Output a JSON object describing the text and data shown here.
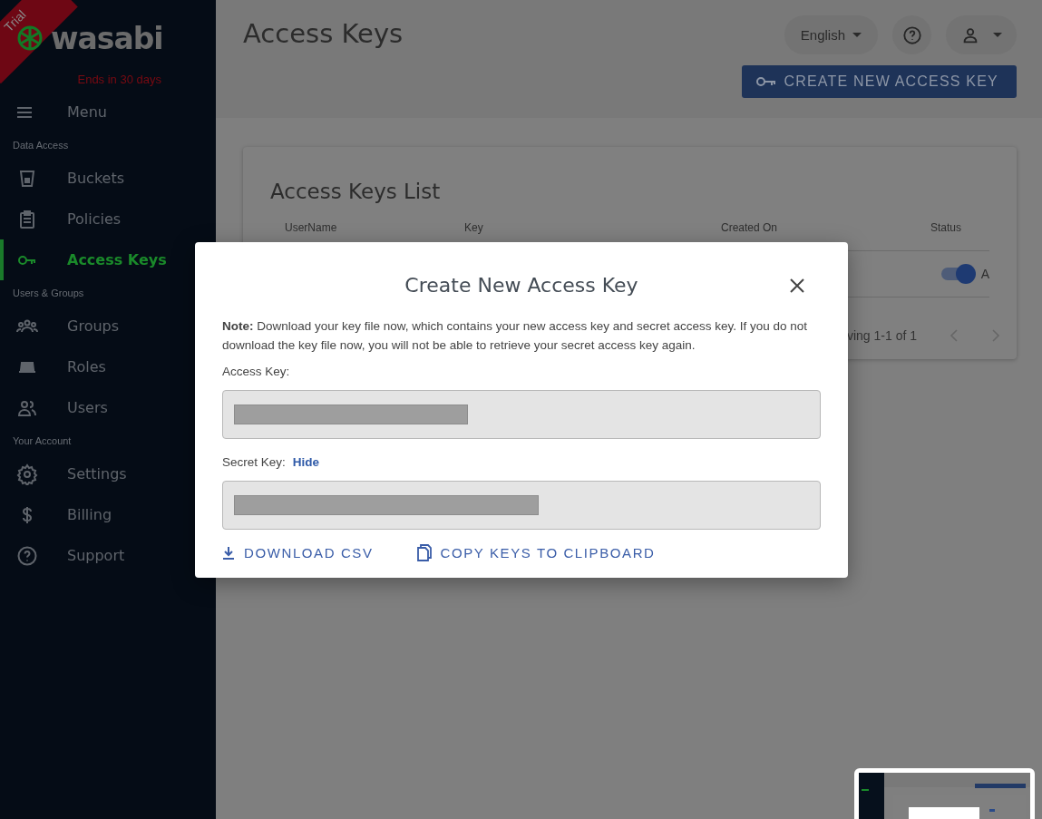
{
  "sidebar": {
    "trial_badge": "Trial",
    "logo": "wasabi",
    "trial_notice": "Ends in 30 days",
    "menu_label": "Menu",
    "sections": [
      {
        "title": "Data Access",
        "items": [
          {
            "label": "Buckets",
            "selected": false
          },
          {
            "label": "Policies",
            "selected": false
          },
          {
            "label": "Access Keys",
            "selected": true
          }
        ]
      },
      {
        "title": "Users & Groups",
        "items": [
          {
            "label": "Groups",
            "selected": false
          },
          {
            "label": "Roles",
            "selected": false
          },
          {
            "label": "Users",
            "selected": false
          }
        ]
      },
      {
        "title": "Your Account",
        "items": [
          {
            "label": "Settings",
            "selected": false
          },
          {
            "label": "Billing",
            "selected": false
          },
          {
            "label": "Support",
            "selected": false
          }
        ]
      }
    ]
  },
  "header": {
    "title": "Access Keys",
    "language": "English",
    "create_button": "CREATE NEW ACCESS KEY"
  },
  "card": {
    "title": "Access Keys List",
    "columns": [
      "UserName",
      "Key",
      "Created On",
      "Status"
    ],
    "rows": [
      {
        "status_on": true,
        "status_text": "A"
      }
    ],
    "pagination": "ving 1-1 of 1"
  },
  "modal": {
    "title": "Create New Access Key",
    "note": "**Note:** Download your key file now, which contains your new access key and secret access key. If you do not download the key file now, you will not be able to retrieve your secret access key again.",
    "fields": [
      {
        "label": "Access Key:"
      },
      {
        "label": "Secret Key:",
        "link": "Hide"
      }
    ],
    "actions": [
      {
        "label": "DOWNLOAD CSV",
        "kind": "download"
      },
      {
        "label": "COPY KEYS TO CLIPBOARD",
        "kind": "copy"
      }
    ]
  }
}
